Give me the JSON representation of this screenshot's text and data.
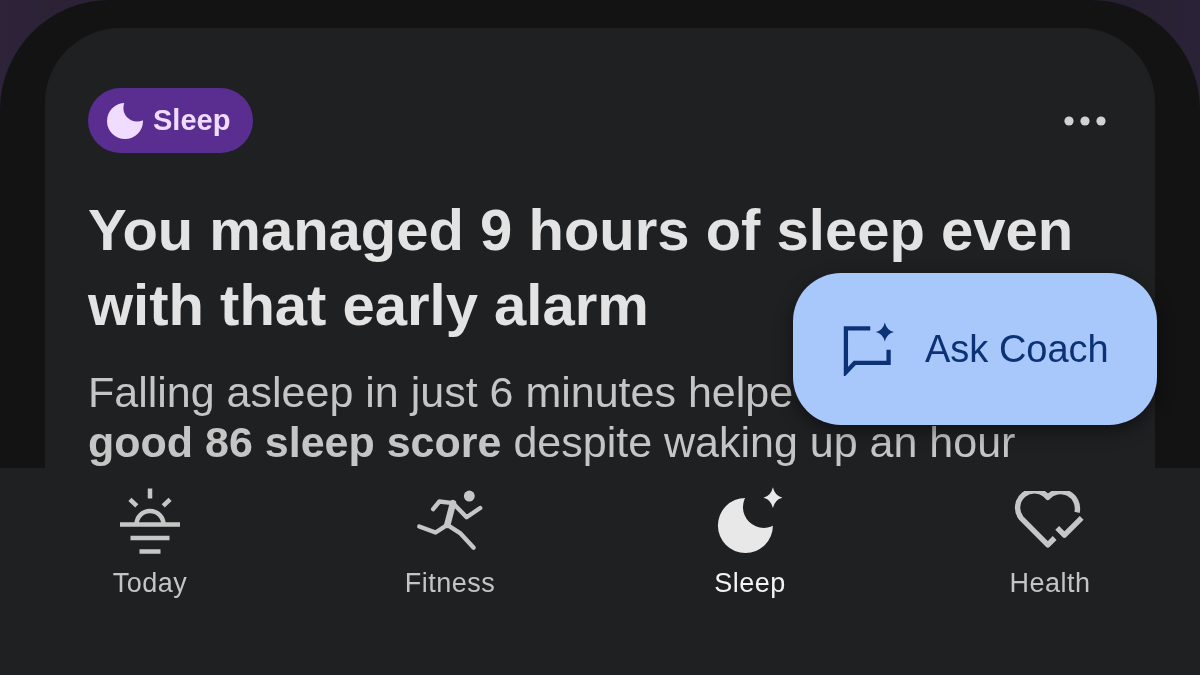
{
  "card": {
    "tag": {
      "label": "Sleep"
    },
    "headline": "You managed 9 hours of sleep even with that early alarm",
    "body": "Falling asleep in just 6 minutes helpe\n**good 86 sleep score** despite waking up an hour"
  },
  "ask_coach_button": {
    "label": "Ask Coach"
  },
  "nav": [
    {
      "label": "Today",
      "selected": false
    },
    {
      "label": "Fitness",
      "selected": false
    },
    {
      "label": "Sleep",
      "selected": true
    },
    {
      "label": "Health",
      "selected": false
    }
  ]
}
